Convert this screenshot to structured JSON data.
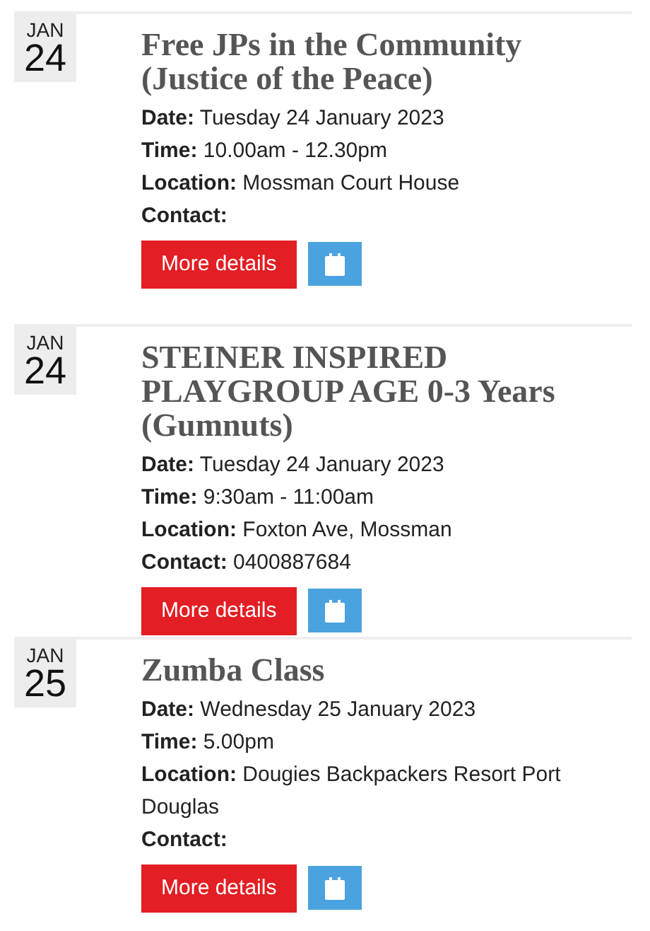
{
  "events": [
    {
      "month": "JAN",
      "day": "24",
      "title": "Free JPs in the Community (Justice of the Peace)",
      "fields": [
        {
          "label": "Date:",
          "value": "Tuesday 24 January 2023"
        },
        {
          "label": "Time:",
          "value": "10.00am - 12.30pm"
        },
        {
          "label": "Location:",
          "value": "Mossman Court House"
        },
        {
          "label": "Contact:"
        }
      ],
      "button": "More details"
    },
    {
      "month": "JAN",
      "day": "24",
      "title": "STEINER INSPIRED PLAYGROUP AGE 0-3 Years (Gumnuts)",
      "fields": [
        {
          "label": "Date:",
          "value": "Tuesday 24 January 2023"
        },
        {
          "label": "Time:",
          "value": "9:30am - 11:00am"
        },
        {
          "label": "Location:",
          "value": "Foxton Ave, Mossman"
        },
        {
          "label": "Contact:",
          "value": "0400887684"
        }
      ],
      "button": "More details"
    },
    {
      "month": "JAN",
      "day": "25",
      "title": "Zumba Class",
      "fields": [
        {
          "label": "Date:",
          "value": "Wednesday 25 January 2023"
        },
        {
          "label": "Time:",
          "value": "5.00pm"
        },
        {
          "label": "Location:",
          "value": "Dougies Backpackers Resort Port Douglas"
        },
        {
          "label": "Contact:"
        }
      ],
      "button": "More details"
    }
  ]
}
